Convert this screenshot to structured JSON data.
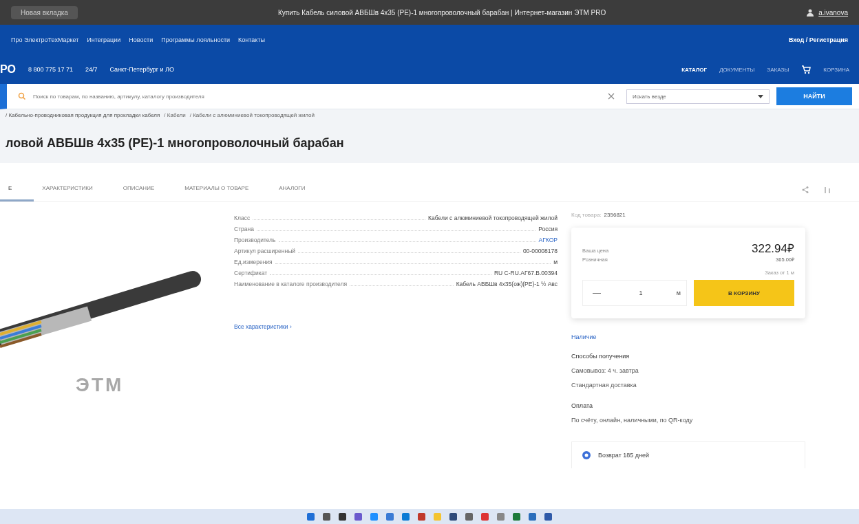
{
  "window": {
    "tab": "Новая вкладка",
    "title": "Купить Кабель силовой АВБШв 4х35 (PE)-1 многопроволочный барабан | Интернет-магазин ЭТМ PRO",
    "account": "a.ivanova"
  },
  "top_nav": {
    "links": [
      "Про ЭлектроТехМаркет",
      "Интеграции",
      "Новости",
      "Программы лояльности",
      "Контакты"
    ],
    "login": "Вход / Регистрация"
  },
  "header": {
    "logo": "РО",
    "phone": "8 800 775 17 71",
    "hours": "24/7",
    "region": "Санкт-Петербург и ЛО",
    "menu": [
      "КАТАЛОГ",
      "ДОКУМЕНТЫ",
      "ЗАКАЗЫ"
    ],
    "cart": "КОРЗИНА"
  },
  "search": {
    "placeholder": "Поиск по товарам, по названию, артикулу, каталогу производителя",
    "scope": "Искать везде",
    "button": "НАЙТИ"
  },
  "breadcrumbs": [
    "/ Кабельно-проводниковая продукция для прокладки кабеля",
    "/ Кабели",
    "/ Кабели с алюминиевой токопроводящей жилой"
  ],
  "product_title": "ловой АВБШв 4х35 (PE)-1 многопроволочный барабан",
  "tabs": [
    {
      "label": "Е",
      "selected": true
    },
    {
      "label": "ХАРАКТЕРИСТИКИ",
      "selected": false
    },
    {
      "label": "ОПИСАНИЕ",
      "selected": false
    },
    {
      "label": "МАТЕРИАЛЫ О ТОВАРЕ",
      "selected": false
    },
    {
      "label": "АНАЛОГИ",
      "selected": false
    }
  ],
  "image_watermark_text": "ЭТМ",
  "specs": [
    {
      "name": "Класс",
      "value": "Кабели с алюминиевой токопроводящей жилой",
      "kind": "text"
    },
    {
      "name": "Страна",
      "value": "Россия",
      "kind": "text"
    },
    {
      "name": "Производитель",
      "value": "АГКОР",
      "kind": "link"
    },
    {
      "name": "Артикул расширенный",
      "value": "00-00008178",
      "kind": "text"
    },
    {
      "name": "Ед.измерения",
      "value": "м",
      "kind": "text"
    },
    {
      "name": "Сертификат",
      "value": "RU C-RU.АГ67.В.00394",
      "kind": "text"
    },
    {
      "name": "Наименование в каталоге производителя",
      "value": "Кабель АВБШв 4х35(ож)(PE)-1 ½ Авс",
      "kind": "text"
    }
  ],
  "all_specs_link": "Все характеристики ›",
  "code": {
    "label": "Код товара:",
    "value": "2356821"
  },
  "price": {
    "your_label": "Ваша цена",
    "your_price": "322.94₽",
    "retail_label": "Розничная",
    "retail_price": "365.00₽",
    "min_order": "Заказ от 1 м",
    "quantity": "1",
    "unit": "м",
    "minus": "—",
    "add": "В КОРЗИНУ"
  },
  "availability": "Наличие",
  "delivery": {
    "title": "Способы получения",
    "options": [
      "Самовывоз: 4 ч. завтра",
      "Стандартная доставка"
    ]
  },
  "payment": {
    "title": "Оплата",
    "text": "По счёту, онлайн, наличными, по QR-коду"
  },
  "return_info": "Возврат 185 дней"
}
